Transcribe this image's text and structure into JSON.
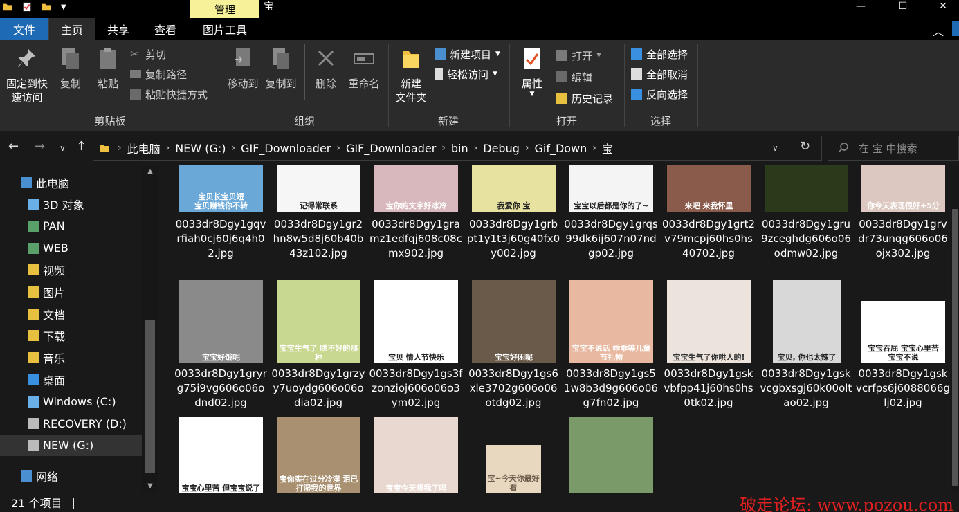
{
  "window": {
    "title": "宝",
    "context_tab": "管理",
    "controls": {
      "minimize": "—",
      "maximize": "☐",
      "close": "✕"
    }
  },
  "tabs": [
    {
      "label": "文件"
    },
    {
      "label": "主页"
    },
    {
      "label": "共享"
    },
    {
      "label": "查看"
    },
    {
      "label": "图片工具"
    }
  ],
  "ribbon": {
    "clipboard": {
      "label": "剪贴板",
      "pin": "固定到快速访问",
      "copy": "复制",
      "paste": "粘贴",
      "cut": "剪切",
      "copy_path": "复制路径",
      "paste_shortcut": "粘贴快捷方式"
    },
    "organize": {
      "label": "组织",
      "move_to": "移动到",
      "copy_to": "复制到",
      "delete": "删除",
      "rename": "重命名"
    },
    "new": {
      "label": "新建",
      "new_folder": "新建\n文件夹",
      "new_item": "新建项目",
      "easy_access": "轻松访问"
    },
    "open": {
      "label": "打开",
      "properties": "属性",
      "open": "打开",
      "edit": "编辑",
      "history": "历史记录"
    },
    "select": {
      "label": "选择",
      "select_all": "全部选择",
      "select_none": "全部取消",
      "invert": "反向选择"
    }
  },
  "address": {
    "crumbs": [
      "此电脑",
      "NEW (G:)",
      "GIF_Downloader",
      "GIF_Downloader",
      "bin",
      "Debug",
      "Gif_Down",
      "宝"
    ],
    "search_placeholder": "在 宝 中搜索"
  },
  "nav": [
    {
      "label": "此电脑",
      "icon": "pc-icon"
    },
    {
      "label": "3D 对象",
      "icon": "3d-objects-icon"
    },
    {
      "label": "PAN",
      "icon": "network-drive-icon"
    },
    {
      "label": "WEB",
      "icon": "network-drive-icon"
    },
    {
      "label": "视频",
      "icon": "videos-icon"
    },
    {
      "label": "图片",
      "icon": "pictures-icon"
    },
    {
      "label": "文档",
      "icon": "documents-icon"
    },
    {
      "label": "下载",
      "icon": "downloads-icon"
    },
    {
      "label": "音乐",
      "icon": "music-icon"
    },
    {
      "label": "桌面",
      "icon": "desktop-icon"
    },
    {
      "label": "Windows (C:)",
      "icon": "windows-drive-icon"
    },
    {
      "label": "RECOVERY (D:)",
      "icon": "drive-icon"
    },
    {
      "label": "NEW (G:)",
      "icon": "drive-icon"
    },
    {
      "label": "网络",
      "icon": "network-icon"
    }
  ],
  "files": [
    {
      "name": "0033dr8Dgy1gqvrfiah0cj60j6q4h02.jpg",
      "caption": "宝贝长宝贝短\n宝贝赚钱你不转",
      "bg": "#6aa8d8",
      "fg": "#ffffff"
    },
    {
      "name": "0033dr8Dgy1gr2hn8w5d8j60b40b43z102.jpg",
      "caption": "记得常联系",
      "bg": "#f6f6f6",
      "fg": "#222222"
    },
    {
      "name": "0033dr8Dgy1gramz1edfqj608c08cmx902.jpg",
      "caption": "宝你的文字好冰冷",
      "bg": "#d8b8bc",
      "fg": "#ffffff"
    },
    {
      "name": "0033dr8Dgy1grbpt1y1t3j60g40fx0y002.jpg",
      "caption": "我爱你 宝",
      "bg": "#e8e2a0",
      "fg": "#222222"
    },
    {
      "name": "0033dr8Dgy1grqs99dk6ij607n07ndgp02.jpg",
      "caption": "宝宝以后都是你的了~",
      "bg": "#f4f4f4",
      "fg": "#222222"
    },
    {
      "name": "0033dr8Dgy1grt2v79mcpj60hs0hs40702.jpg",
      "caption": "来吧 来我怀里",
      "bg": "#8a5a4a",
      "fg": "#ffffff"
    },
    {
      "name": "0033dr8Dgy1gru9zceghdg606o06odmw02.jpg",
      "caption": "",
      "bg": "#2a3a1a",
      "fg": "#ffffff"
    },
    {
      "name": "0033dr8Dgy1grvdr73unqg606o06ojx302.jpg",
      "caption": "你今天表现很好+5分",
      "bg": "#dcc8c0",
      "fg": "#ffffff"
    },
    {
      "name": "0033dr8Dgy1gryrg75i9vg606o06odnd02.jpg",
      "caption": "宝宝好饿呢",
      "bg": "#8a8a8a",
      "fg": "#ffffff"
    },
    {
      "name": "0033dr8Dgy1grzyy7uoydg606o06odia02.jpg",
      "caption": "宝宝生气了 哄不好的那种",
      "bg": "#c8d890",
      "fg": "#ffffff"
    },
    {
      "name": "0033dr8Dgy1gs3fzonzioj606o06o3ym02.jpg",
      "caption": "宝贝 情人节快乐",
      "bg": "#ffffff",
      "fg": "#222222"
    },
    {
      "name": "0033dr8Dgy1gs6xle3702g606o06otdg02.jpg",
      "caption": "宝宝好困呢",
      "bg": "#6a5a4a",
      "fg": "#ffffff"
    },
    {
      "name": "0033dr8Dgy1gs51w8b3d9g606o06g7fn02.jpg",
      "caption": "宝宝不说话 乖乖等儿童节礼物",
      "bg": "#e8b8a0",
      "fg": "#ffffff"
    },
    {
      "name": "0033dr8Dgy1gskvbfpp41j60hs0hs0tk02.jpg",
      "caption": "宝宝生气了你哄人的!",
      "bg": "#ece4dc",
      "fg": "#333333"
    },
    {
      "name": "0033dr8Dgy1gskvcgbxsgj60k00oltao02.jpg",
      "caption": "宝贝, 你也太辣了",
      "bg": "#d8d8d8",
      "fg": "#222222"
    },
    {
      "name": "0033dr8Dgy1gskvcrfps6j6088066glj02.jpg",
      "caption": "宝宝吞屁 宝宝心里苦 宝宝不说",
      "bg": "#ffffff",
      "fg": "#222222"
    },
    {
      "name": "",
      "caption": "宝宝心里苦 但宝宝说了",
      "bg": "#ffffff",
      "fg": "#222222"
    },
    {
      "name": "",
      "caption": "宝你实在过分冷漠 泪已打湿我的世界",
      "bg": "#a89070",
      "fg": "#ffffff"
    },
    {
      "name": "",
      "caption": "宝宝今天想我了吗",
      "bg": "#e8d8d0",
      "fg": "#ffffff"
    },
    {
      "name": "",
      "caption": "宝~今天你最好看",
      "bg": "#e8d8c0",
      "fg": "#6a5a4a"
    },
    {
      "name": "",
      "caption": "",
      "bg": "#7a9a6a",
      "fg": "#ffffff"
    }
  ],
  "status": {
    "item_count": "21 个项目"
  },
  "watermark": "破走论坛: www.pozou.com"
}
